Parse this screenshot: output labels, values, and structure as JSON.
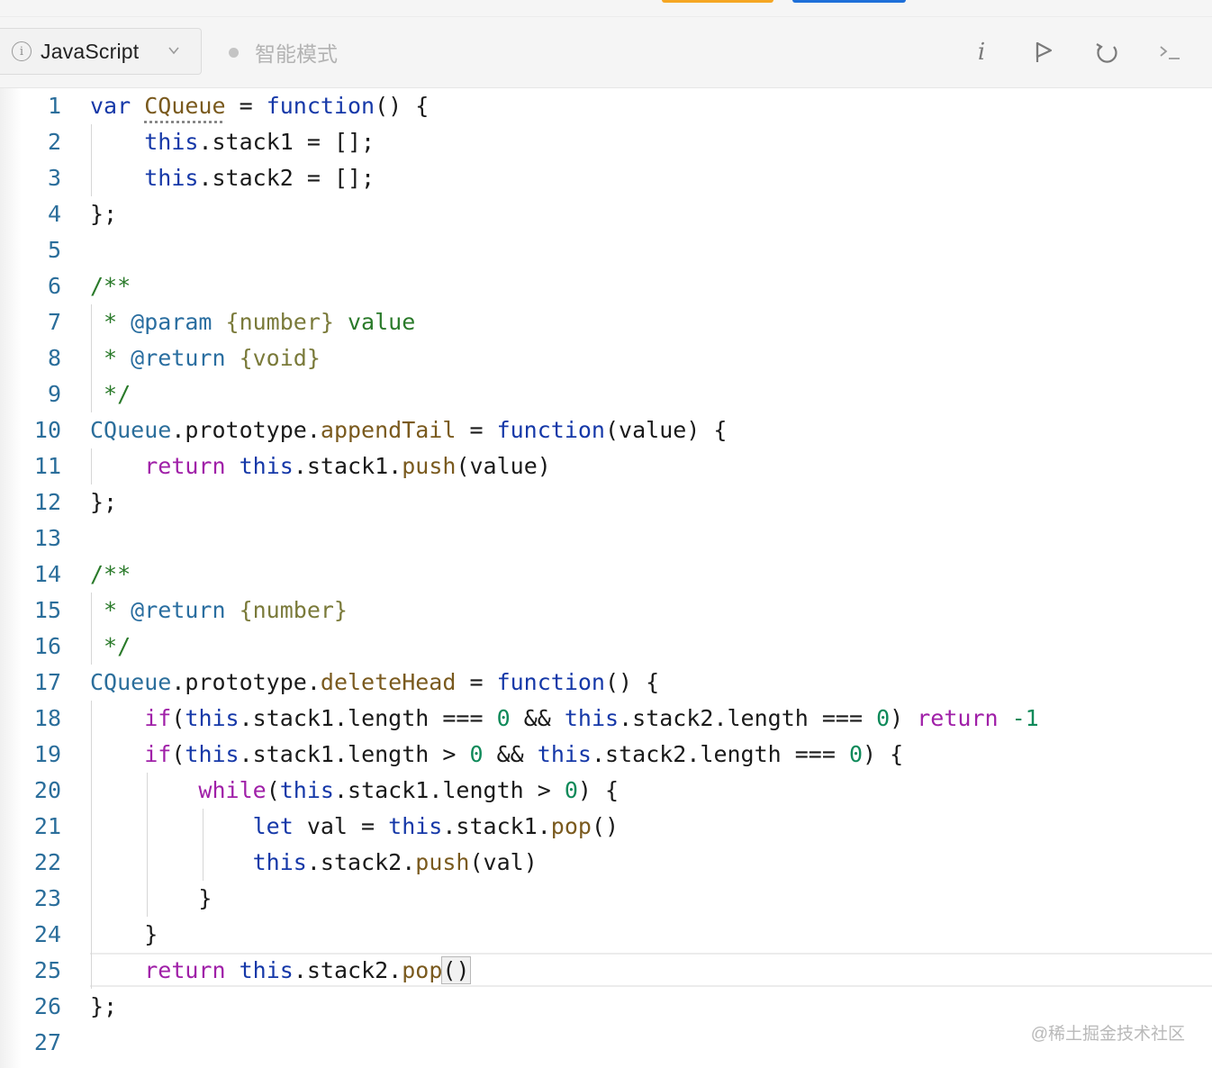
{
  "toolbar": {
    "language": "JavaScript",
    "mode": "智能模式",
    "info_icon": "i"
  },
  "icons": {
    "language_info": "info-circle-icon",
    "language_dropdown": "chevron-down-icon",
    "mode_status": "status-dot-icon",
    "info": "info-icon",
    "run": "run-flag-icon",
    "reset": "reset-icon",
    "console": "terminal-icon"
  },
  "editor": {
    "active_line": 25,
    "line_numbers": [
      "1",
      "2",
      "3",
      "4",
      "5",
      "6",
      "7",
      "8",
      "9",
      "10",
      "11",
      "12",
      "13",
      "14",
      "15",
      "16",
      "17",
      "18",
      "19",
      "20",
      "21",
      "22",
      "23",
      "24",
      "25",
      "26",
      "27"
    ],
    "lines": [
      "var CQueue = function() {",
      "    this.stack1 = [];",
      "    this.stack2 = [];",
      "};",
      "",
      "/**",
      " * @param {number} value",
      " * @return {void}",
      " */",
      "CQueue.prototype.appendTail = function(value) {",
      "    return this.stack1.push(value)",
      "};",
      "",
      "/**",
      " * @return {number}",
      " */",
      "CQueue.prototype.deleteHead = function() {",
      "    if(this.stack1.length === 0 && this.stack2.length === 0) return -1",
      "    if(this.stack1.length > 0 && this.stack2.length === 0) {",
      "        while(this.stack1.length > 0) {",
      "            let val = this.stack1.pop()",
      "            this.stack2.push(val)",
      "        }",
      "    }",
      "    return this.stack2.pop()",
      "};",
      ""
    ]
  },
  "watermark": "@稀土掘金技术社区",
  "colors": {
    "keyword": "#1538a8",
    "control": "#a020a8",
    "function": "#7a5a1e",
    "number": "#0f8a5a",
    "comment": "#2a7a2a",
    "line_number": "#2b6e9b"
  }
}
